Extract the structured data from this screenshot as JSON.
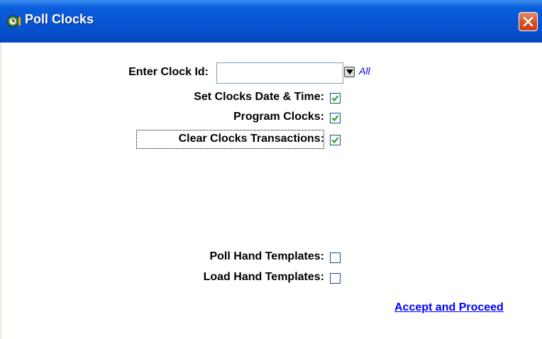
{
  "window": {
    "title": "Poll Clocks",
    "icon": "clock-app-icon",
    "close_icon": "close-icon"
  },
  "form": {
    "clock_id_label": "Enter Clock Id:",
    "clock_id_value": "",
    "clock_id_placeholder": "",
    "all_link": "All",
    "set_date_time_label": "Set Clocks Date & Time:",
    "set_date_time_checked": true,
    "program_clocks_label": "Program Clocks:",
    "program_clocks_checked": true,
    "clear_transactions_label": "Clear Clocks Transactions:",
    "clear_transactions_checked": true,
    "poll_hand_templates_label": "Poll Hand Templates:",
    "poll_hand_templates_checked": false,
    "load_hand_templates_label": "Load Hand Templates:",
    "load_hand_templates_checked": false
  },
  "actions": {
    "accept_label": "Accept and Proceed"
  },
  "colors": {
    "title_bar": "#0853d2",
    "close_button": "#d84a1c",
    "link": "#0000ff",
    "check": "#21a121"
  }
}
